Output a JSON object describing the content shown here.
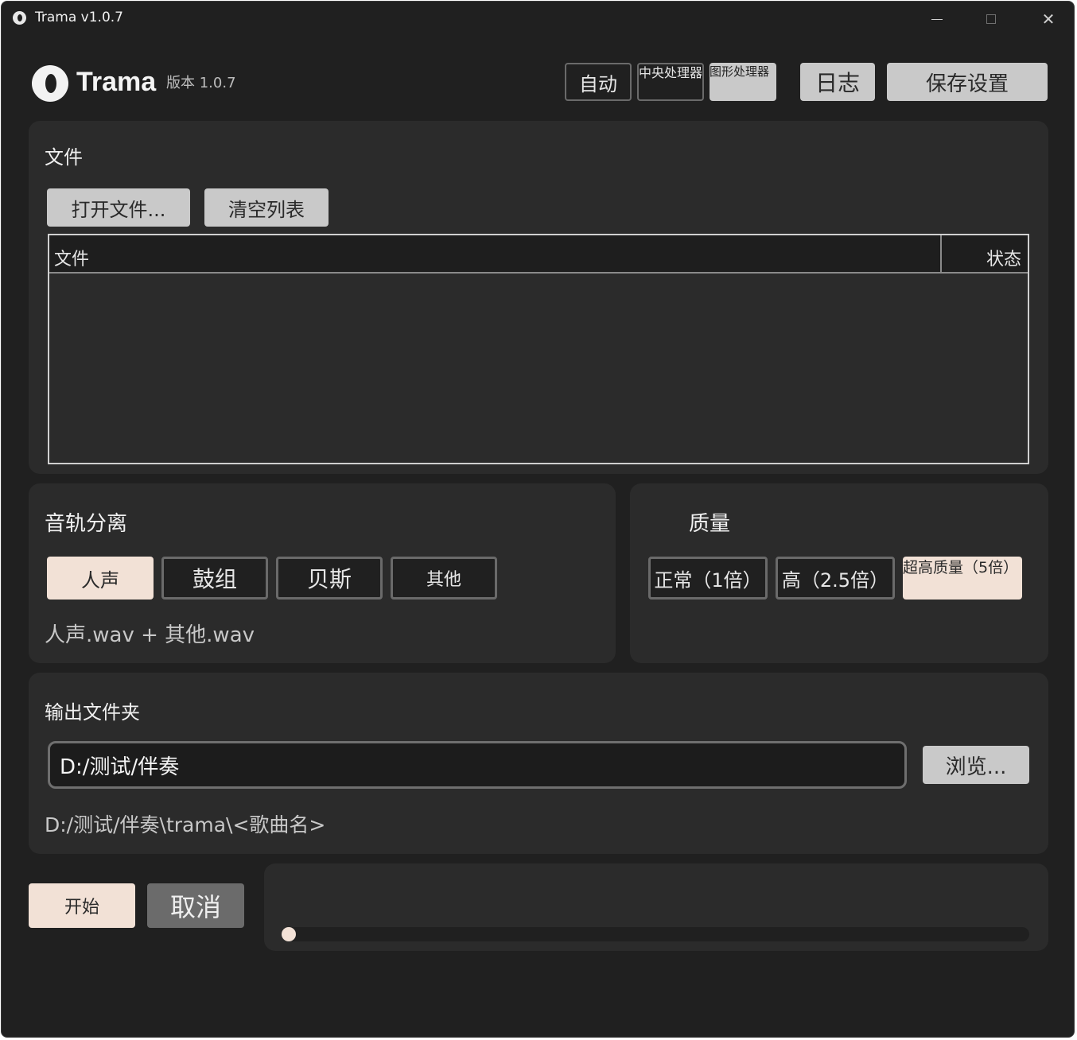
{
  "window": {
    "title": "Trama v1.0.7"
  },
  "header": {
    "app_name": "Trama",
    "version": "版本 1.0.7",
    "device_buttons": [
      "自动",
      "中央处理器",
      "图形处理器"
    ],
    "log_label": "日志",
    "save_label": "保存设置"
  },
  "files": {
    "title": "文件",
    "open_label": "打开文件...",
    "clear_label": "清空列表",
    "columns": [
      "文件",
      "状态"
    ]
  },
  "separation": {
    "title": "音轨分离",
    "options": [
      "人声",
      "鼓组",
      "贝斯",
      "其他"
    ],
    "selected": "人声",
    "hint": "人声.wav + 其他.wav"
  },
  "quality": {
    "title": "质量",
    "options": [
      "正常（1倍）",
      "高（2.5倍）",
      "超高质量（5倍）"
    ],
    "selected": "超高质量（5倍）"
  },
  "output": {
    "title": "输出文件夹",
    "path": "D:/测试/伴奏",
    "browse_label": "浏览...",
    "resolved_path": "D:/测试/伴奏\\trama\\<歌曲名>"
  },
  "actions": {
    "start_label": "开始",
    "cancel_label": "取消"
  },
  "progress": {
    "value": 0
  },
  "colors": {
    "background": "#202020",
    "panel": "#2b2b2b",
    "accent": "#f2e1d6",
    "button_gray": "#c9c9c9"
  }
}
